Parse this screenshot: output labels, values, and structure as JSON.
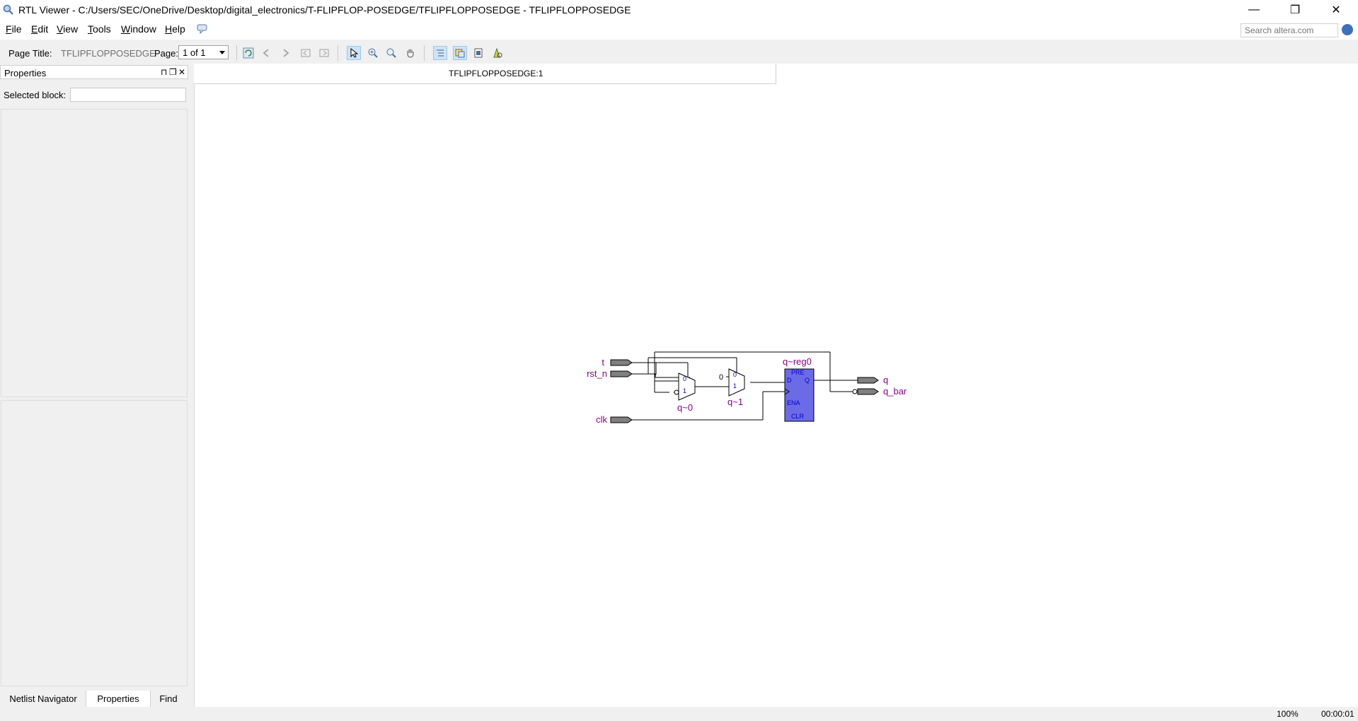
{
  "window": {
    "title": "RTL Viewer - C:/Users/SEC/OneDrive/Desktop/digital_electronics/T-FLIPFLOP-POSEDGE/TFLIPFLOPPOSEDGE - TFLIPFLOPPOSEDGE",
    "minimize": "—",
    "restore": "❐",
    "close": "✕"
  },
  "menu": {
    "items": [
      {
        "acc": "F",
        "rest": "ile"
      },
      {
        "acc": "E",
        "rest": "dit"
      },
      {
        "acc": "V",
        "rest": "iew"
      },
      {
        "acc": "T",
        "rest": "ools"
      },
      {
        "acc": "W",
        "rest": "indow"
      },
      {
        "acc": "H",
        "rest": "elp"
      }
    ],
    "search_placeholder": "Search altera.com"
  },
  "toolbar": {
    "page_title_label": "Page Title:",
    "page_title_value": "TFLIPFLOPPOSEDGE",
    "page_label": "Page:",
    "page_value": "1 of 1"
  },
  "properties": {
    "title": "Properties",
    "pin": "⊓",
    "float": "❐",
    "close": "✕",
    "selected_block_label": "Selected block:"
  },
  "bottom_tabs": [
    "Netlist Navigator",
    "Properties",
    "Find"
  ],
  "document": {
    "tab_title": "TFLIPFLOPPOSEDGE:1"
  },
  "schematic": {
    "inputs": [
      "t",
      "rst_n",
      "clk"
    ],
    "outputs": [
      "q",
      "q_bar"
    ],
    "mux0": {
      "name": "q~0",
      "in0": "0",
      "in1": "1"
    },
    "mux1": {
      "name": "q~1",
      "in0": "0",
      "in1": "1",
      "const": "0"
    },
    "reg": {
      "name": "q~reg0",
      "pre": "PRE",
      "d": "D",
      "q": "Q",
      "ena": "ENA",
      "clr": "CLR"
    },
    "colors": {
      "label": "#8b008b",
      "port_fill": "#808080",
      "reg_fill": "#6b6be6",
      "reg_text": "#0000cc"
    }
  },
  "status": {
    "zoom": "100%",
    "time": "00:00:01"
  }
}
